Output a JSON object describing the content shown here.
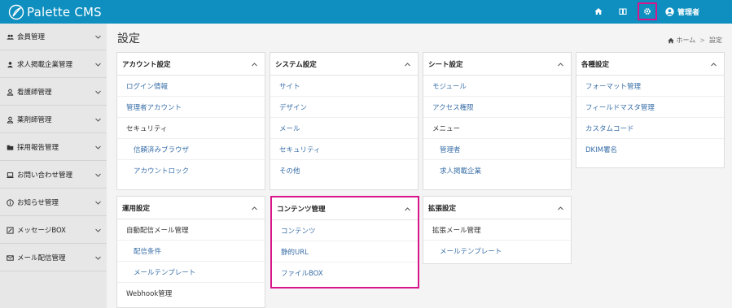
{
  "header": {
    "app_name": "Palette CMS",
    "user_name": "管理者",
    "icons": [
      "home-icon",
      "book-icon",
      "gear-icon",
      "user-circle-icon"
    ],
    "highlight_color": "#d6168a",
    "brand_color": "#0e8fc0"
  },
  "sidebar": {
    "items": [
      {
        "label": "会員管理",
        "icon": "users-icon"
      },
      {
        "label": "求人掲載企業管理",
        "icon": "user-icon"
      },
      {
        "label": "看護師管理",
        "icon": "person-icon"
      },
      {
        "label": "薬剤師管理",
        "icon": "person-icon"
      },
      {
        "label": "採用報告管理",
        "icon": "folder-icon"
      },
      {
        "label": "お問い合わせ管理",
        "icon": "laptop-icon"
      },
      {
        "label": "お知らせ管理",
        "icon": "info-icon"
      },
      {
        "label": "メッセージBOX",
        "icon": "message-box-icon"
      },
      {
        "label": "メール配信管理",
        "icon": "envelope-icon"
      }
    ]
  },
  "main": {
    "title": "設定",
    "breadcrumb": {
      "home": "ホーム",
      "sep": ">",
      "current": "設定"
    },
    "cards": [
      {
        "title": "アカウント設定",
        "items": [
          {
            "label": "ログイン情報",
            "style": "link"
          },
          {
            "label": "管理者アカウント",
            "style": "link"
          },
          {
            "label": "セキュリティ",
            "style": "plain"
          },
          {
            "label": "信頼済みブラウザ",
            "style": "sublink"
          },
          {
            "label": "アカウントロック",
            "style": "sublink"
          }
        ]
      },
      {
        "title": "システム設定",
        "items": [
          {
            "label": "サイト",
            "style": "link"
          },
          {
            "label": "デザイン",
            "style": "link"
          },
          {
            "label": "メール",
            "style": "link"
          },
          {
            "label": "セキュリティ",
            "style": "link"
          },
          {
            "label": "その他",
            "style": "link"
          }
        ]
      },
      {
        "title": "シート設定",
        "items": [
          {
            "label": "モジュール",
            "style": "link"
          },
          {
            "label": "アクセス権限",
            "style": "link"
          },
          {
            "label": "メニュー",
            "style": "plain"
          },
          {
            "label": "管理者",
            "style": "sublink"
          },
          {
            "label": "求人掲載企業",
            "style": "sublink"
          }
        ]
      },
      {
        "title": "各種設定",
        "items": [
          {
            "label": "フォーマット管理",
            "style": "link"
          },
          {
            "label": "フィールドマスタ管理",
            "style": "link"
          },
          {
            "label": "カスタムコード",
            "style": "link"
          },
          {
            "label": "DKIM署名",
            "style": "link"
          }
        ]
      },
      {
        "title": "運用設定",
        "items": [
          {
            "label": "自動配信メール管理",
            "style": "plain"
          },
          {
            "label": "配信条件",
            "style": "sublink"
          },
          {
            "label": "メールテンプレート",
            "style": "sublink"
          },
          {
            "label": "Webhook管理",
            "style": "plain"
          }
        ]
      },
      {
        "title": "コンテンツ管理",
        "items": [
          {
            "label": "コンテンツ",
            "style": "link"
          },
          {
            "label": "静的URL",
            "style": "link"
          },
          {
            "label": "ファイルBOX",
            "style": "link"
          }
        ]
      },
      {
        "title": "拡張設定",
        "items": [
          {
            "label": "拡張メール管理",
            "style": "plain"
          },
          {
            "label": "メールテンプレート",
            "style": "sublink"
          }
        ]
      }
    ]
  }
}
